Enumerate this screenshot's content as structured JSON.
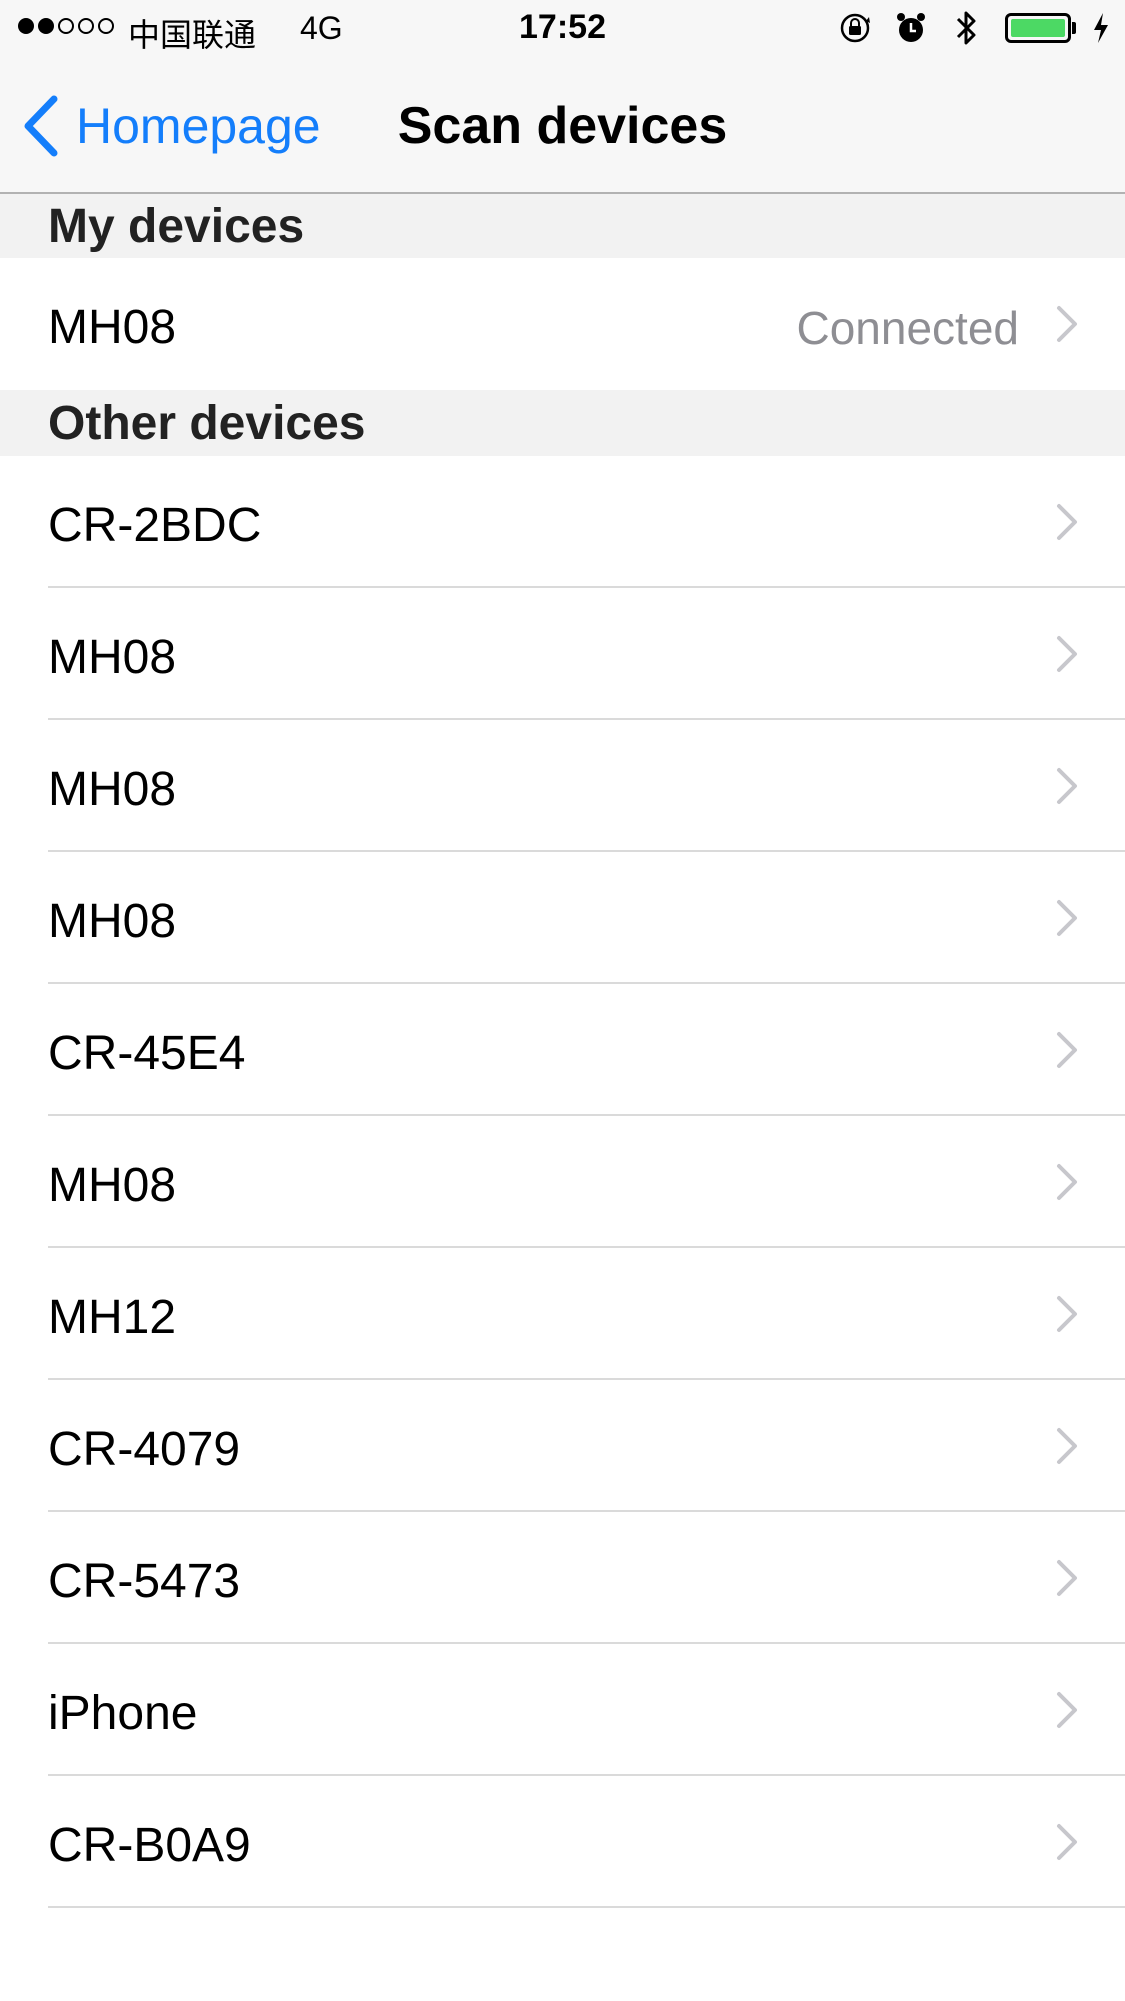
{
  "status_bar": {
    "signal_filled": 2,
    "signal_total": 5,
    "carrier": "中国联通",
    "network": "4G",
    "time": "17:52",
    "icons": [
      "rotation-lock-icon",
      "alarm-icon",
      "bluetooth-icon",
      "battery-icon",
      "charging-icon"
    ],
    "battery_level": 1.0,
    "battery_color": "#4cd964"
  },
  "nav": {
    "back_label": "Homepage",
    "title": "Scan devices",
    "accent": "#147efb"
  },
  "sections": {
    "my_devices": {
      "header": "My devices",
      "items": [
        {
          "name": "MH08",
          "detail": "Connected"
        }
      ]
    },
    "other_devices": {
      "header": "Other devices",
      "items": [
        {
          "name": "CR-2BDC"
        },
        {
          "name": "MH08"
        },
        {
          "name": "MH08"
        },
        {
          "name": "MH08"
        },
        {
          "name": "CR-45E4"
        },
        {
          "name": "MH08"
        },
        {
          "name": "MH12"
        },
        {
          "name": "CR-4079"
        },
        {
          "name": "CR-5473"
        },
        {
          "name": "iPhone"
        },
        {
          "name": "CR-B0A9"
        }
      ]
    }
  }
}
